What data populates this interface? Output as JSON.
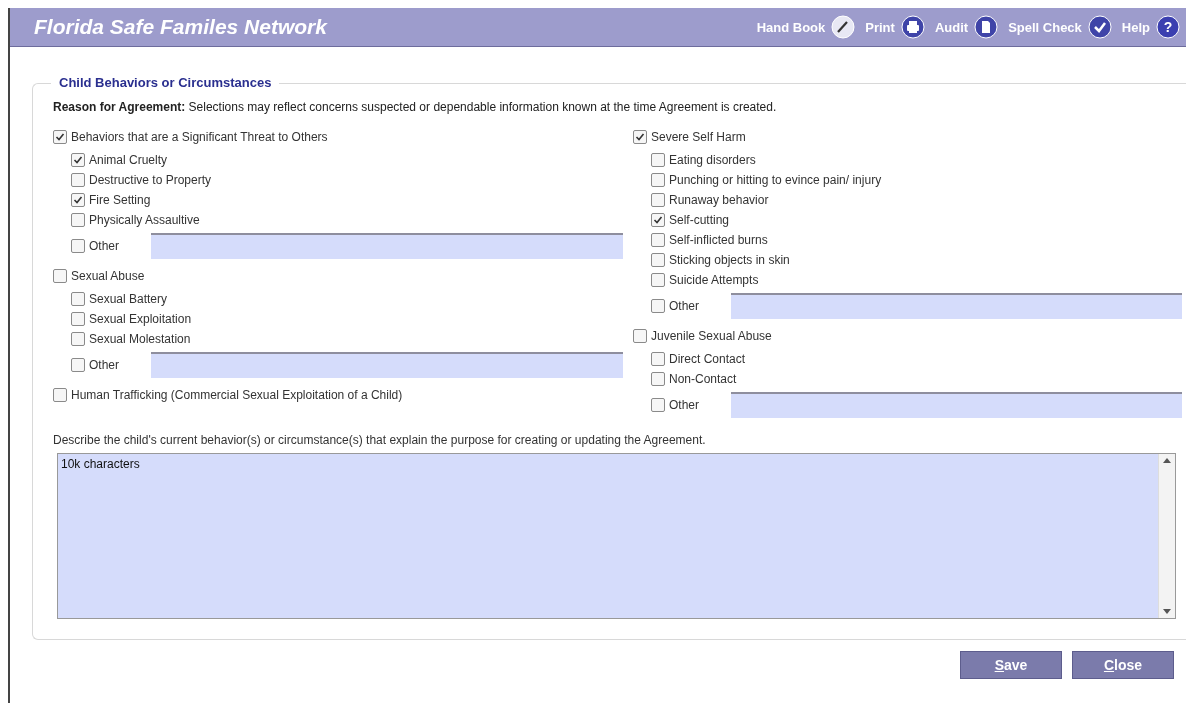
{
  "window": {
    "title": "Florida Safe Familes Network"
  },
  "toolbar": [
    {
      "label": "Hand Book",
      "kind": "pen"
    },
    {
      "label": "Print",
      "kind": "printer"
    },
    {
      "label": "Audit",
      "kind": "document"
    },
    {
      "label": "Spell Check",
      "kind": "check"
    },
    {
      "label": "Help",
      "kind": "help",
      "glyph": "?"
    }
  ],
  "section": {
    "title": "Child Behaviors or Circumstances",
    "reason_label": "Reason for Agreement:",
    "reason_text": "Selections may reflect concerns suspected or dependable information known at the time Agreement is created."
  },
  "columns": [
    [
      {
        "label": "Behaviors that are a Significant Threat to Others",
        "checked": true,
        "items": [
          {
            "label": "Animal Cruelty",
            "checked": true
          },
          {
            "label": "Destructive to Property",
            "checked": false
          },
          {
            "label": "Fire Setting",
            "checked": true
          },
          {
            "label": "Physically Assaultive",
            "checked": false
          }
        ],
        "other": {
          "label": "Other",
          "checked": false
        }
      },
      {
        "label": "Sexual Abuse",
        "checked": false,
        "items": [
          {
            "label": "Sexual Battery",
            "checked": false
          },
          {
            "label": "Sexual Exploitation",
            "checked": false
          },
          {
            "label": "Sexual Molestation",
            "checked": false
          }
        ],
        "other": {
          "label": "Other",
          "checked": false
        }
      },
      {
        "label": "Human Trafficking (Commercial Sexual Exploitation of a Child)",
        "checked": false
      }
    ],
    [
      {
        "label": "Severe Self Harm",
        "checked": true,
        "items": [
          {
            "label": "Eating disorders",
            "checked": false
          },
          {
            "label": "Punching or hitting to evince pain/ injury",
            "checked": false
          },
          {
            "label": "Runaway behavior",
            "checked": false
          },
          {
            "label": "Self-cutting",
            "checked": true
          },
          {
            "label": "Self-inflicted burns",
            "checked": false
          },
          {
            "label": "Sticking objects in skin",
            "checked": false
          },
          {
            "label": "Suicide Attempts",
            "checked": false
          }
        ],
        "other": {
          "label": "Other",
          "checked": false
        }
      },
      {
        "label": "Juvenile Sexual Abuse",
        "checked": false,
        "items": [
          {
            "label": "Direct Contact",
            "checked": false
          },
          {
            "label": "Non-Contact",
            "checked": false
          }
        ],
        "other": {
          "label": "Other",
          "checked": false
        }
      }
    ]
  ],
  "description": {
    "label": "Describe the child's current behavior(s) or circumstance(s) that explain the purpose for creating or updating the Agreement.",
    "value": "10k characters"
  },
  "buttons": [
    "Save",
    "Close"
  ]
}
